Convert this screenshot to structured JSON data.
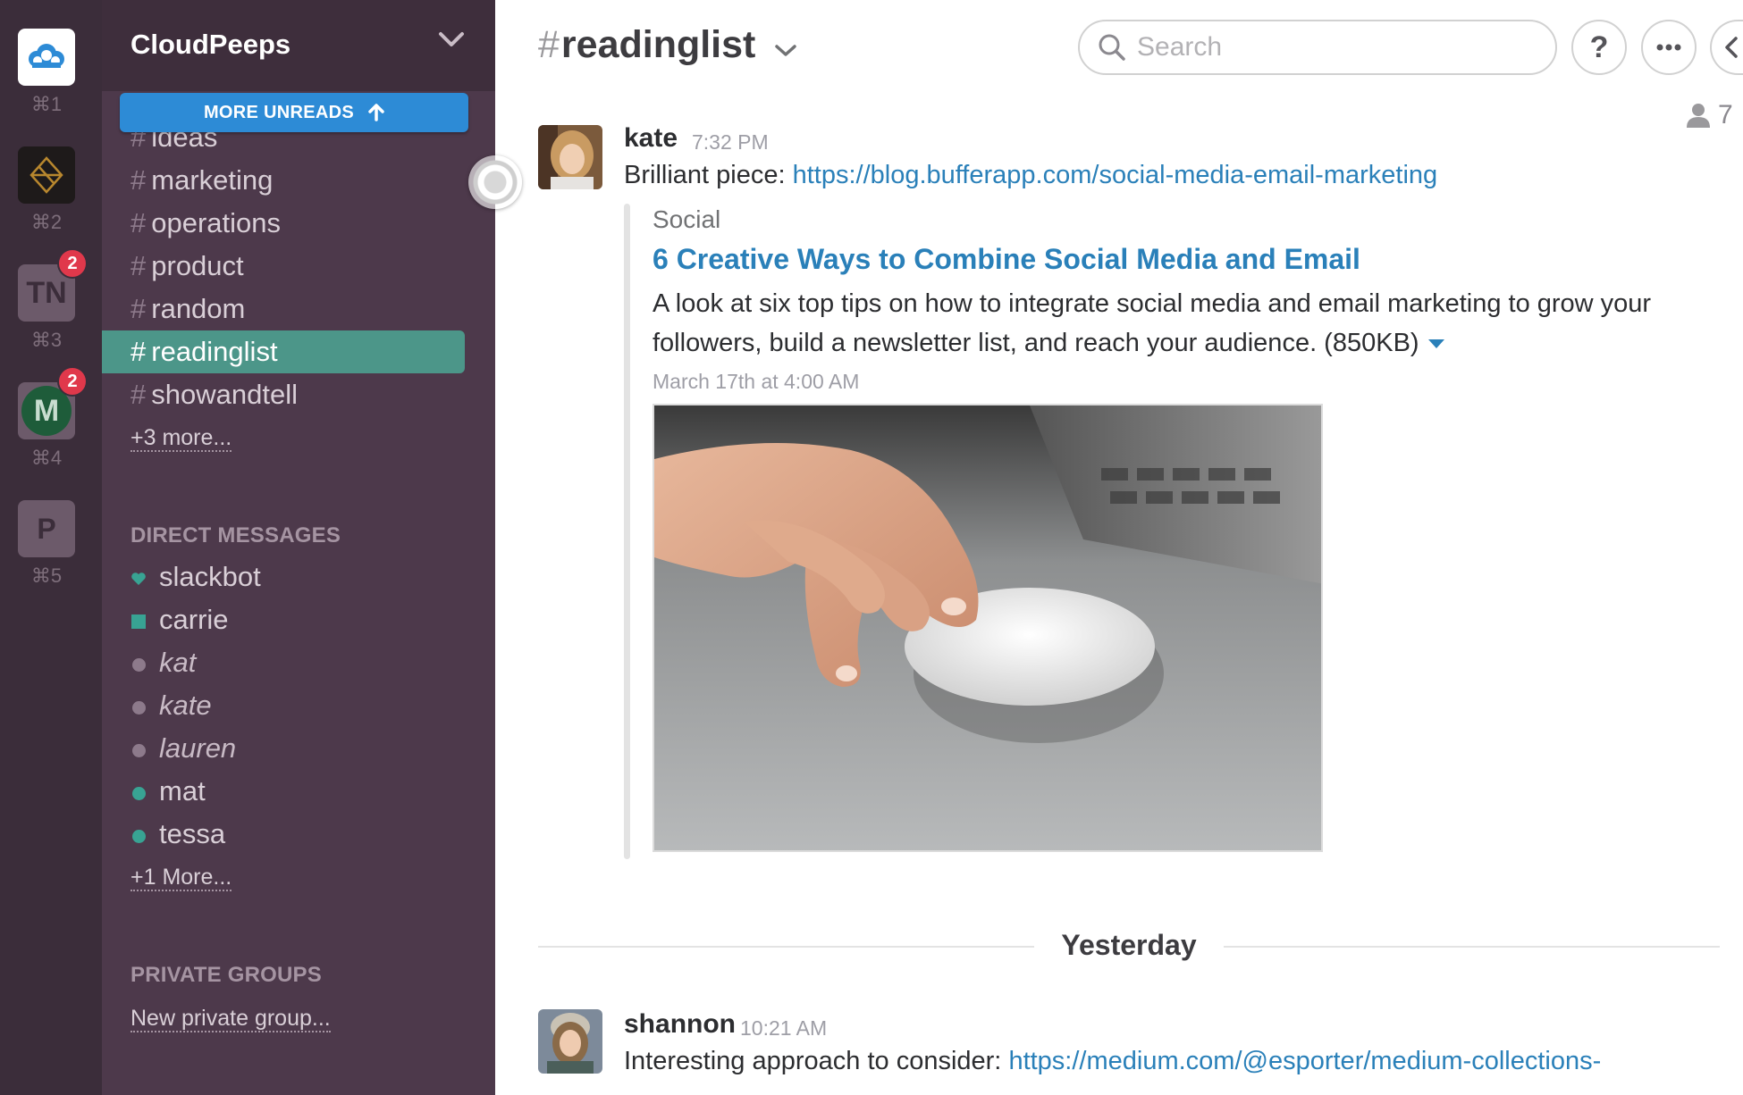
{
  "teams": [
    {
      "shortcut": "⌘1",
      "label": "",
      "badge": ""
    },
    {
      "shortcut": "⌘2",
      "label": "",
      "badge": ""
    },
    {
      "shortcut": "⌘3",
      "label": "TN",
      "badge": "2"
    },
    {
      "shortcut": "⌘4",
      "label": "M",
      "badge": "2"
    },
    {
      "shortcut": "⌘5",
      "label": "P",
      "badge": ""
    }
  ],
  "sidebar": {
    "team_name": "CloudPeeps",
    "more_unreads": "MORE UNREADS",
    "channels": [
      "ideas",
      "marketing",
      "operations",
      "product",
      "random",
      "readinglist",
      "showandtell"
    ],
    "active_channel": "readinglist",
    "more_channels": "+3 more...",
    "dm_header": "DIRECT MESSAGES",
    "direct_messages": [
      {
        "name": "slackbot",
        "status": "slackbot"
      },
      {
        "name": "carrie",
        "status": "online-square"
      },
      {
        "name": "kat",
        "status": "away"
      },
      {
        "name": "kate",
        "status": "away"
      },
      {
        "name": "lauren",
        "status": "away"
      },
      {
        "name": "mat",
        "status": "online"
      },
      {
        "name": "tessa",
        "status": "online"
      }
    ],
    "more_dms": "+1 More...",
    "groups_header": "PRIVATE GROUPS",
    "new_group": "New private group..."
  },
  "header": {
    "hash": "#",
    "channel": "readinglist",
    "search_placeholder": "Search",
    "help": "?",
    "member_count": "7"
  },
  "messages": [
    {
      "sender": "kate",
      "time": "7:32 PM",
      "prefix": "Brilliant piece: ",
      "link": "https://blog.bufferapp.com/social-media-email-marketing",
      "attachment": {
        "service": "Social",
        "title": "6 Creative Ways to Combine Social Media and Email",
        "description": "A look at six top tips on how to integrate social media and email marketing to grow your followers, build a newsletter list, and reach your audience. (850KB)",
        "date": "March 17th at 4:00 AM"
      }
    },
    {
      "sender": "shannon",
      "time": "10:21 AM",
      "prefix": "Interesting approach to consider: ",
      "link": "https://medium.com/@esporter/medium-collections-"
    }
  ],
  "divider": "Yesterday",
  "colors": {
    "rail": "#3b2d3a",
    "sidebar": "#4d394b",
    "active": "#4c9689",
    "accent_blue": "#2d8bd6",
    "link": "#2a80b9",
    "badge": "#e0384b"
  }
}
